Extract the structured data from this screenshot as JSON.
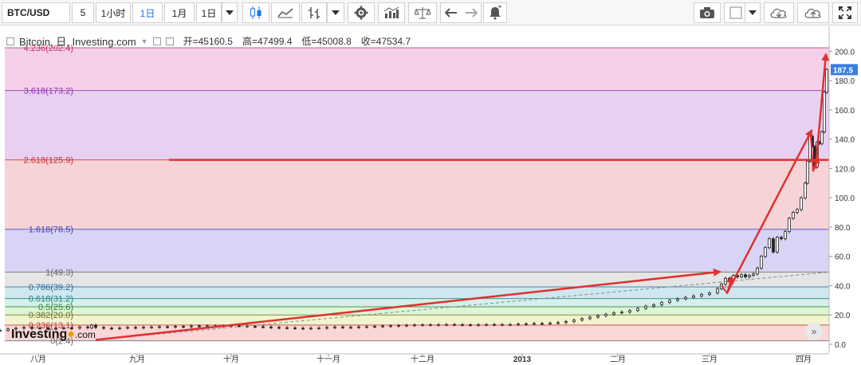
{
  "toolbar": {
    "symbol": "BTC/USD",
    "interval_value": "5",
    "timeframes": [
      "1小时",
      "1日",
      "1月",
      "1日"
    ],
    "active_timeframe": "1日",
    "icons": [
      "dropdown-icon",
      "candlestick-icon",
      "line-chart-icon",
      "bar-chart-icon",
      "dropdown-icon",
      "settings-icon",
      "indicators-icon",
      "balance-icon",
      "undo-icon",
      "redo-icon",
      "alert-icon",
      "camera-icon",
      "color-box-icon",
      "dropdown-icon",
      "cloud-download-icon",
      "cloud-upload-icon",
      "fullscreen-icon"
    ]
  },
  "header": {
    "title": "Bitcoin, 日, Investing.com",
    "open": "开=45160.5",
    "high": "高=47499.4",
    "low": "低=45008.8",
    "close": "收=47534.7"
  },
  "watermark": {
    "brand": "Investing",
    "suffix": ".com"
  },
  "scroll_button": "»",
  "colors": {
    "fib_4236": "#f5d0ea",
    "fib_3618": "#e8d0f0",
    "fib_2618": "#f5d3d7",
    "fib_1618": "#d8d4f5",
    "fib_1": "#e5e5e5",
    "fib_0786": "#cfe8f0",
    "fib_0618": "#d4f0e8",
    "fib_05": "#def5d6",
    "fib_0382": "#f0f5d0",
    "fib_0236": "#fad6d6",
    "arrow": "#e03030",
    "price_tag": "#3b7de0"
  },
  "chart_data": {
    "type": "line",
    "title": "Bitcoin, 日, Investing.com",
    "x_ticks": [
      "八月",
      "九月",
      "十月",
      "十一月",
      "十二月",
      "2013",
      "二月",
      "三月",
      "四月"
    ],
    "y_ticks": [
      0.0,
      20.0,
      40.0,
      60.0,
      80.0,
      100.0,
      120.0,
      140.0,
      160.0,
      180.0,
      200.0
    ],
    "ylim": [
      0,
      202.4
    ],
    "last_price": "187.5",
    "fib_levels": [
      {
        "label": "4.236(202.4)",
        "value": 202.4,
        "color": "#c0306a"
      },
      {
        "label": "3.618(173.2)",
        "value": 173.2,
        "color": "#9030b0"
      },
      {
        "label": "2.618(125.9)",
        "value": 125.9,
        "color": "#c03030"
      },
      {
        "label": "1.618(78.5)",
        "value": 78.5,
        "color": "#4040b0"
      },
      {
        "label": "1(49.3)",
        "value": 49.3,
        "color": "#666666"
      },
      {
        "label": "0.786(39.2)",
        "value": 39.2,
        "color": "#2a6aa0"
      },
      {
        "label": "0.618(31.2)",
        "value": 31.2,
        "color": "#208080"
      },
      {
        "label": "0.5(25.6)",
        "value": 25.6,
        "color": "#308030"
      },
      {
        "label": "0.382(20.0)",
        "value": 20.0,
        "color": "#707020"
      },
      {
        "label": "0.236(13.1)",
        "value": 13.1,
        "color": "#c03030"
      },
      {
        "label": "0(2.4)",
        "value": 2.4,
        "color": "#666666"
      }
    ],
    "series": [
      {
        "values": [
          [
            0,
            9.5
          ],
          [
            10,
            10.5
          ],
          [
            20,
            11
          ],
          [
            30,
            11.5
          ],
          [
            40,
            10.8
          ],
          [
            50,
            11.2
          ],
          [
            60,
            10.5
          ],
          [
            70,
            10.9
          ],
          [
            80,
            11.2
          ],
          [
            90,
            11.0
          ],
          [
            100,
            11.8
          ],
          [
            110,
            11.3
          ],
          [
            115,
            13
          ],
          [
            120,
            11.5
          ],
          [
            130,
            11.0
          ],
          [
            140,
            10.8
          ],
          [
            150,
            11.2
          ],
          [
            160,
            11.5
          ],
          [
            170,
            11.3
          ],
          [
            180,
            11.6
          ],
          [
            190,
            11.8
          ],
          [
            200,
            12.0
          ],
          [
            210,
            11.8
          ],
          [
            220,
            12.2
          ],
          [
            230,
            12.0
          ],
          [
            240,
            12.5
          ],
          [
            250,
            12.2
          ],
          [
            260,
            12.5
          ],
          [
            270,
            12.3
          ],
          [
            280,
            12.6
          ],
          [
            290,
            12.8
          ],
          [
            300,
            12.5
          ],
          [
            310,
            12.2
          ],
          [
            320,
            12.0
          ],
          [
            330,
            11.8
          ],
          [
            340,
            11.5
          ],
          [
            350,
            11.3
          ],
          [
            360,
            11.2
          ],
          [
            370,
            11.0
          ],
          [
            380,
            10.8
          ],
          [
            390,
            11.0
          ],
          [
            400,
            11.2
          ],
          [
            410,
            11.5
          ],
          [
            420,
            11.8
          ],
          [
            430,
            11.5
          ],
          [
            440,
            11.6
          ],
          [
            450,
            11.9
          ],
          [
            460,
            12.0
          ],
          [
            470,
            12.2
          ],
          [
            480,
            12.5
          ],
          [
            490,
            12.6
          ],
          [
            500,
            12.8
          ],
          [
            510,
            13.0
          ],
          [
            520,
            13.2
          ],
          [
            530,
            13.3
          ],
          [
            540,
            13.3
          ],
          [
            550,
            13.4
          ],
          [
            560,
            13.5
          ],
          [
            570,
            13.4
          ],
          [
            580,
            13.3
          ],
          [
            590,
            13.2
          ],
          [
            600,
            13.4
          ],
          [
            610,
            13.5
          ],
          [
            620,
            13.4
          ],
          [
            630,
            13.5
          ],
          [
            640,
            13.5
          ],
          [
            650,
            13.8
          ],
          [
            660,
            14.0
          ],
          [
            670,
            14.2
          ],
          [
            680,
            14.0
          ],
          [
            690,
            14.5
          ],
          [
            700,
            14.8
          ],
          [
            710,
            15.5
          ],
          [
            720,
            16.5
          ],
          [
            730,
            17.5
          ],
          [
            740,
            18.5
          ],
          [
            750,
            19.5
          ],
          [
            760,
            20.5
          ],
          [
            770,
            21.5
          ],
          [
            780,
            22.0
          ],
          [
            790,
            23.0
          ],
          [
            800,
            24.5
          ],
          [
            810,
            26.0
          ],
          [
            820,
            27.0
          ],
          [
            830,
            28.5
          ],
          [
            840,
            30.0
          ],
          [
            850,
            31.0
          ],
          [
            860,
            32.0
          ],
          [
            870,
            33.0
          ],
          [
            880,
            34.0
          ],
          [
            890,
            35.0
          ],
          [
            900,
            38.0
          ],
          [
            905,
            41.0
          ],
          [
            910,
            45.0
          ],
          [
            915,
            44.0
          ],
          [
            920,
            47.0
          ],
          [
            925,
            46.0
          ],
          [
            930,
            47.5
          ],
          [
            935,
            46.0
          ],
          [
            940,
            47.0
          ],
          [
            945,
            48.0
          ],
          [
            950,
            52.0
          ],
          [
            955,
            60.0
          ],
          [
            960,
            66.0
          ],
          [
            965,
            72.0
          ],
          [
            970,
            63.0
          ],
          [
            975,
            73.0
          ],
          [
            980,
            72.0
          ],
          [
            985,
            77.0
          ],
          [
            990,
            86.0
          ],
          [
            995,
            90.0
          ],
          [
            1000,
            92.0
          ],
          [
            1005,
            100.0
          ],
          [
            1010,
            110.0
          ],
          [
            1013,
            125.0
          ],
          [
            1016,
            142.0
          ],
          [
            1019,
            135.0
          ],
          [
            1022,
            121.0
          ],
          [
            1025,
            138.0
          ],
          [
            1028,
            137.0
          ],
          [
            1031,
            145.0
          ],
          [
            1034,
            172.0
          ],
          [
            1037,
            187.5
          ]
        ]
      }
    ]
  }
}
